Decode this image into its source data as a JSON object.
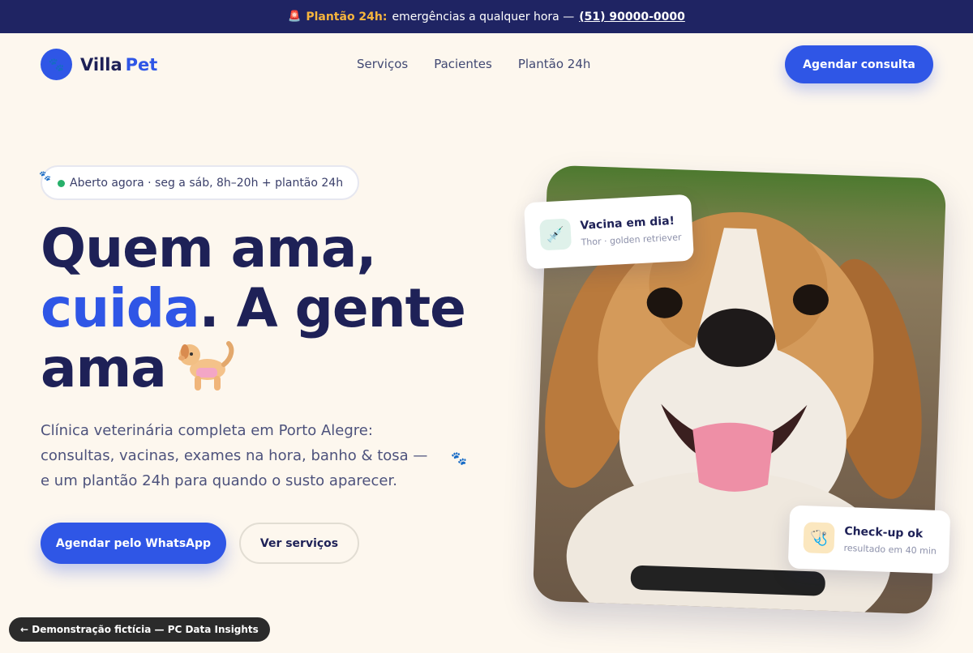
{
  "topbar": {
    "icon": "siren-icon",
    "highlight": "Plantão 24h:",
    "text": "emergências a qualquer hora —",
    "phone": "(51) 90000-0000"
  },
  "header": {
    "logo_icon": "paws-icon",
    "logo_word1": "Villa",
    "logo_word2": "Pet",
    "nav": [
      "Serviços",
      "Pacientes",
      "Plantão 24h"
    ],
    "cta": "Agendar consulta"
  },
  "hero": {
    "status_pill": "Aberto agora · seg a sáb, 8h–20h + plantão 24h",
    "headline_line1": "Quem ama,",
    "headline_blue": "cuida",
    "headline_rest2": ". A gente",
    "headline_line3": "ama",
    "subtitle": "Clínica veterinária completa em Porto Alegre: consultas, vacinas, exames na hora, banho & tosa — e um plantão 24h para quando o susto aparecer.",
    "primary_button": "Agendar pelo WhatsApp",
    "secondary_button": "Ver serviços"
  },
  "cards": {
    "vaccine": {
      "title": "Vacina em dia!",
      "subtitle": "Thor · golden retriever",
      "icon": "syringe-icon"
    },
    "checkup": {
      "title": "Check-up ok",
      "subtitle": "resultado em 40 min",
      "icon": "stethoscope-icon"
    }
  },
  "demo_badge": "← Demonstração fictícia — PC Data Insights",
  "colors": {
    "navy": "#1f2463",
    "accent": "#2f56e6",
    "background": "#fdf7ee",
    "highlight": "#f6b53d"
  }
}
